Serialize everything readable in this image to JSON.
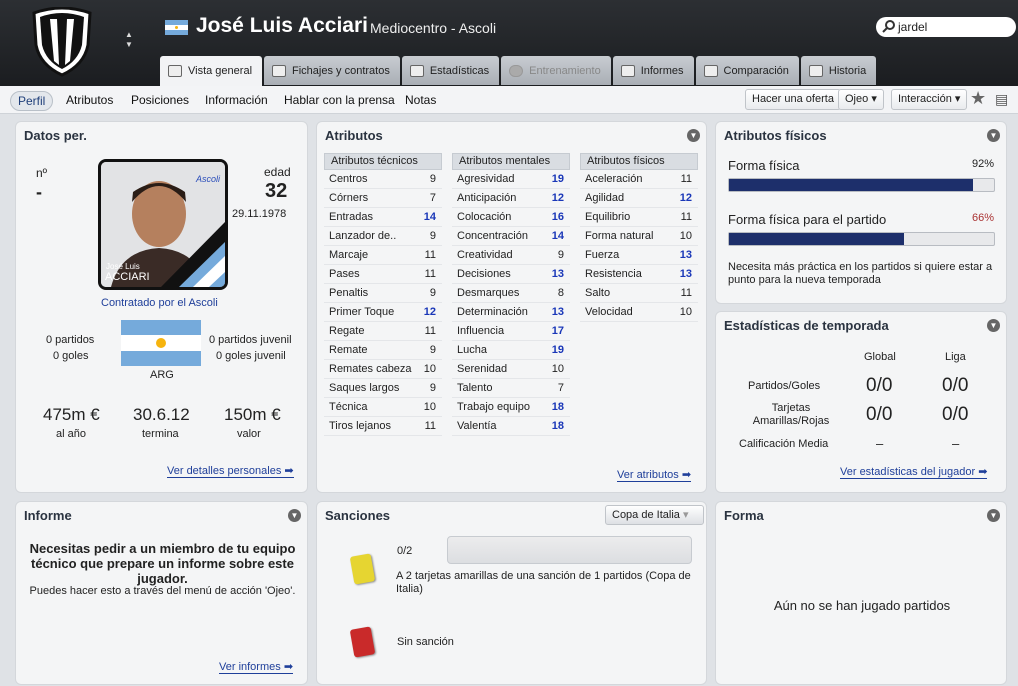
{
  "header": {
    "player_name": "José Luis Acciari",
    "position_club": "Mediocentro - Ascoli",
    "search_value": "jardel"
  },
  "tabs": [
    {
      "label": "Vista general",
      "active": true
    },
    {
      "label": "Fichajes y contratos"
    },
    {
      "label": "Estadísticas"
    },
    {
      "label": "Entrenamiento",
      "disabled": true
    },
    {
      "label": "Informes"
    },
    {
      "label": "Comparación"
    },
    {
      "label": "Historia"
    }
  ],
  "subnav": [
    "Perfil",
    "Atributos",
    "Posiciones",
    "Información",
    "Hablar con la prensa",
    "Notas"
  ],
  "actions": {
    "offer": "Hacer una oferta",
    "scout": "Ojeo",
    "interaction": "Interacción"
  },
  "personal": {
    "title": "Datos per.",
    "number_label": "nº",
    "number_value": "-",
    "age_label": "edad",
    "age_value": "32",
    "birthdate": "29.11.1978",
    "card_first": "José Luis",
    "card_last": "ACCIARI",
    "contracted": "Contratado por el Ascoli",
    "apps": "0 partidos",
    "goals": "0 goles",
    "youth_apps": "0 partidos juvenil",
    "youth_goals": "0 goles juvenil",
    "nation": "ARG",
    "wage": "475m €",
    "wage_label": "al año",
    "expiry": "30.6.12",
    "expiry_label": "termina",
    "value": "150m €",
    "value_label": "valor",
    "link": "Ver detalles personales"
  },
  "attributes": {
    "title": "Atributos",
    "link": "Ver atributos",
    "technical": {
      "header": "Atributos técnicos",
      "rows": [
        {
          "name": "Centros",
          "value": "9"
        },
        {
          "name": "Córners",
          "value": "7"
        },
        {
          "name": "Entradas",
          "value": "14"
        },
        {
          "name": "Lanzador de..",
          "value": "9"
        },
        {
          "name": "Marcaje",
          "value": "11"
        },
        {
          "name": "Pases",
          "value": "11"
        },
        {
          "name": "Penaltis",
          "value": "9"
        },
        {
          "name": "Primer Toque",
          "value": "12"
        },
        {
          "name": "Regate",
          "value": "11"
        },
        {
          "name": "Remate",
          "value": "9"
        },
        {
          "name": "Remates cabeza",
          "value": "10"
        },
        {
          "name": "Saques largos",
          "value": "9"
        },
        {
          "name": "Técnica",
          "value": "10"
        },
        {
          "name": "Tiros lejanos",
          "value": "11"
        }
      ]
    },
    "mental": {
      "header": "Atributos mentales",
      "rows": [
        {
          "name": "Agresividad",
          "value": "19"
        },
        {
          "name": "Anticipación",
          "value": "12"
        },
        {
          "name": "Colocación",
          "value": "16"
        },
        {
          "name": "Concentración",
          "value": "14"
        },
        {
          "name": "Creatividad",
          "value": "9"
        },
        {
          "name": "Decisiones",
          "value": "13"
        },
        {
          "name": "Desmarques",
          "value": "8"
        },
        {
          "name": "Determinación",
          "value": "13"
        },
        {
          "name": "Influencia",
          "value": "17"
        },
        {
          "name": "Lucha",
          "value": "19"
        },
        {
          "name": "Serenidad",
          "value": "10"
        },
        {
          "name": "Talento",
          "value": "7"
        },
        {
          "name": "Trabajo equipo",
          "value": "18"
        },
        {
          "name": "Valentía",
          "value": "18"
        }
      ]
    },
    "physical": {
      "header": "Atributos físicos",
      "rows": [
        {
          "name": "Aceleración",
          "value": "11"
        },
        {
          "name": "Agilidad",
          "value": "12"
        },
        {
          "name": "Equilibrio",
          "value": "11"
        },
        {
          "name": "Forma natural",
          "value": "10"
        },
        {
          "name": "Fuerza",
          "value": "13"
        },
        {
          "name": "Resistencia",
          "value": "13"
        },
        {
          "name": "Salto",
          "value": "11"
        },
        {
          "name": "Velocidad",
          "value": "10"
        }
      ]
    }
  },
  "physical_panel": {
    "title": "Atributos físicos",
    "fitness_label": "Forma física",
    "fitness_value": "92%",
    "fitness_fraction": 0.92,
    "match_label": "Forma física para el partido",
    "match_value": "66%",
    "match_fraction": 0.66,
    "note": "Necesita más práctica en los partidos si quiere estar a punto para la nueva temporada"
  },
  "season": {
    "title": "Estadísticas de temporada",
    "col_global": "Global",
    "col_league": "Liga",
    "row1": "Partidos/Goles",
    "row1_g": "0/0",
    "row1_l": "0/0",
    "row2": "Tarjetas Amarillas/Rojas",
    "row2_g": "0/0",
    "row2_l": "0/0",
    "row3": "Calificación Media",
    "row3_g": "–",
    "row3_l": "–",
    "link": "Ver estadísticas del jugador"
  },
  "report": {
    "title": "Informe",
    "main": "Necesitas pedir a un miembro de tu equipo técnico que prepare un informe sobre este jugador.",
    "sub": "Puedes hacer esto a través del menú de acción 'Ojeo'.",
    "link": "Ver informes"
  },
  "sanctions": {
    "title": "Sanciones",
    "competition": "Copa de Italia",
    "yellow_count": "0/2",
    "yellow_text": "A 2 tarjetas amarillas de una sanción de 1 partidos (Copa de Italia)",
    "red_text": "Sin sanción",
    "colors": {
      "yellow": "#e6d531",
      "red": "#c92a2a"
    }
  },
  "form": {
    "title": "Forma",
    "empty": "Aún no se han jugado partidos"
  }
}
